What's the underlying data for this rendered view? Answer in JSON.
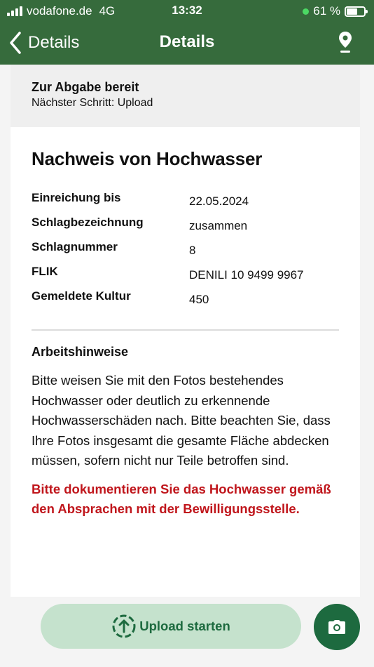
{
  "status_bar": {
    "carrier": "vodafone.de",
    "network": "4G",
    "time": "13:32",
    "battery": "61 %",
    "battery_level": 0.61
  },
  "nav": {
    "back_label": "Details",
    "title": "Details",
    "back_icon": "chevron-left-icon",
    "map_icon": "location-pin-icon"
  },
  "status_card": {
    "title": "Zur Abgabe bereit",
    "subtitle": "Nächster Schritt: Upload"
  },
  "task": {
    "title": "Nachweis von Hochwasser",
    "fields": [
      {
        "label": "Einreichung bis",
        "value": "22.05.2024"
      },
      {
        "label": "Schlagbezeichnung",
        "value": "zusammen"
      },
      {
        "label": "Schlagnummer",
        "value": "8"
      },
      {
        "label": "FLIK",
        "value": "DENILI 10 9499 9967"
      },
      {
        "label": "Gemeldete Kultur",
        "value": "450"
      }
    ],
    "instructions_heading": "Arbeitshinweise",
    "instructions": "Bitte weisen Sie mit den Fotos bestehendes Hochwasser oder deutlich zu erkennende Hochwasserschäden nach. Bitte beachten Sie, dass Ihre Fotos insgesamt die gesamte Fläche abdecken müssen, sofern nicht nur Teile betroffen sind.",
    "warning": "Bitte dokumentieren Sie das Hochwasser gemäß den Absprachen mit der Bewilligungsstelle."
  },
  "actions": {
    "upload_label": "Upload starten",
    "upload_icon": "upload-arrow-icon",
    "camera_icon": "camera-icon"
  },
  "colors": {
    "header_green": "#366b3c",
    "accent_green": "#1d6a3f",
    "button_light_green": "#c5e2cd",
    "warning_red": "#c0161c"
  }
}
